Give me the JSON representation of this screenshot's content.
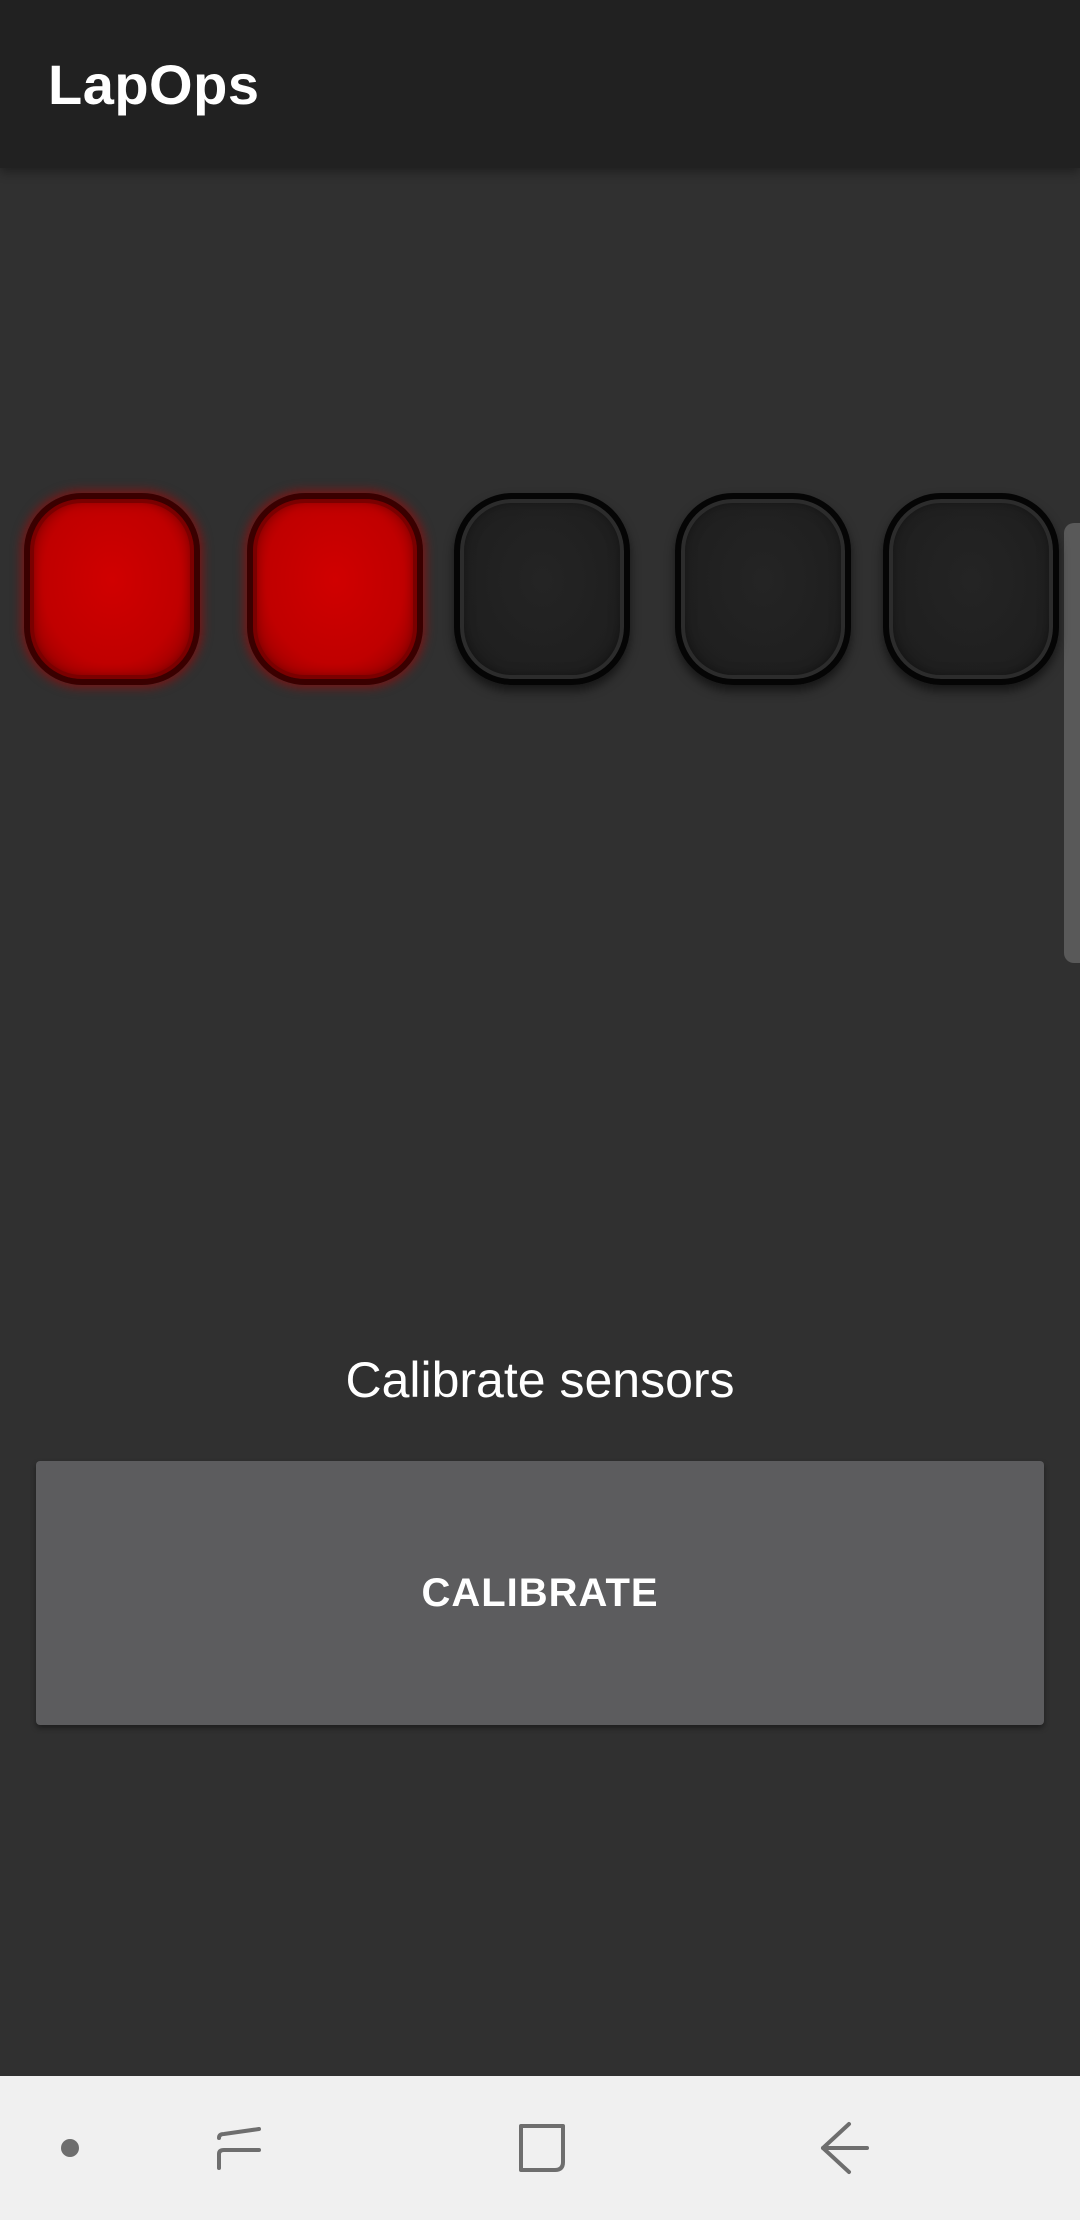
{
  "app_bar": {
    "title": "LapOps"
  },
  "lights": [
    {
      "state": "on",
      "color": "#c80000"
    },
    {
      "state": "on",
      "color": "#c80000"
    },
    {
      "state": "off",
      "color": "#1f1f1f"
    },
    {
      "state": "off",
      "color": "#1f1f1f"
    },
    {
      "state": "off",
      "color": "#1f1f1f"
    }
  ],
  "calibration": {
    "heading": "Calibrate sensors",
    "button_label": "CALIBRATE"
  },
  "navigation": {
    "items": [
      {
        "icon": "dot-icon"
      },
      {
        "icon": "recent-apps-icon"
      },
      {
        "icon": "home-icon"
      },
      {
        "icon": "back-arrow-icon"
      }
    ]
  },
  "colors": {
    "background": "#303030",
    "app_bar": "#212121",
    "button": "#5c5c5e",
    "light_on": "#c80000",
    "nav_bar": "#f0f0f0"
  }
}
